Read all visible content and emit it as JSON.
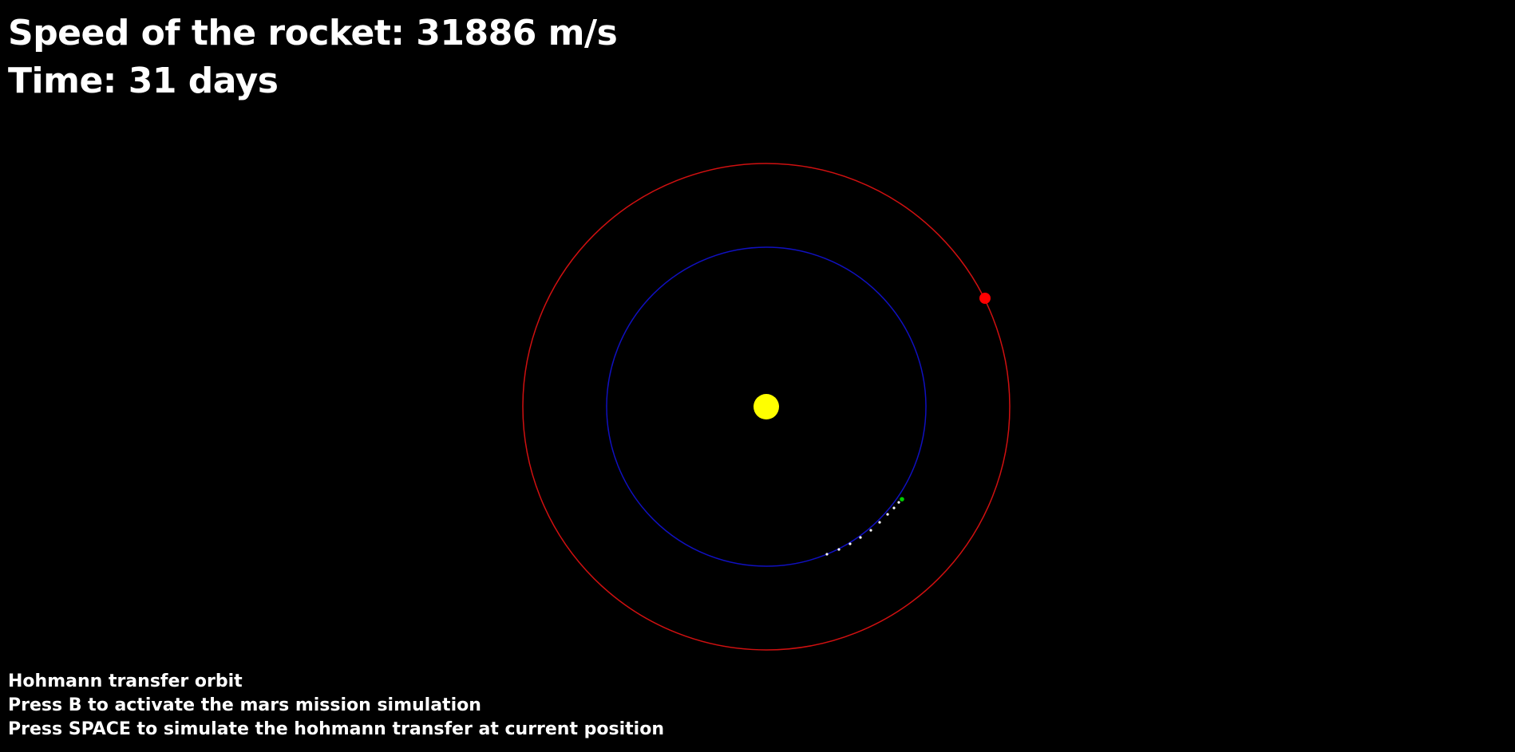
{
  "hud": {
    "speed_text": "Speed of the rocket: 31886 m/s",
    "time_text": "Time: 31 days"
  },
  "instructions": {
    "mode": "Hohmann transfer orbit",
    "line_b": "Press B to activate the mars mission simulation",
    "line_space": "Press SPACE to simulate the hohmann transfer at current position"
  },
  "colors": {
    "background": "#000000",
    "sun": "#ffff00",
    "earth_orbit": "#1010c0",
    "mars_orbit": "#d01010",
    "mars": "#ff0000",
    "rocket": "#00cc00",
    "trail": "#ffffff",
    "text": "#ffffff"
  }
}
